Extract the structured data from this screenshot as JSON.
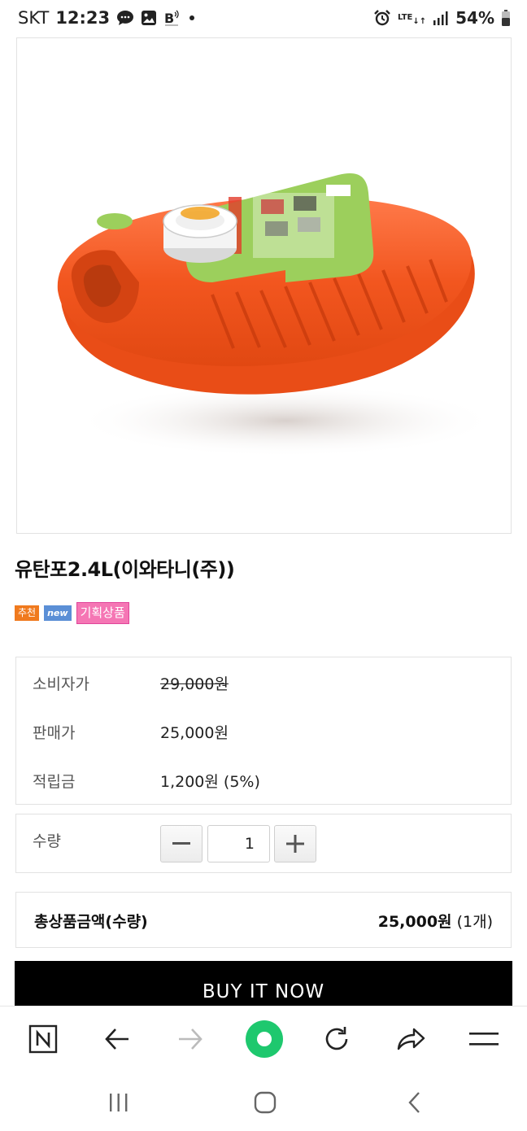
{
  "status_bar": {
    "carrier": "SKT",
    "time": "12:23",
    "network": "LTE",
    "battery": "54%",
    "icons": [
      "chat-icon",
      "gallery-icon",
      "b-icon",
      "dot-icon",
      "alarm-icon",
      "lte-icon",
      "signal-icon",
      "battery-icon"
    ]
  },
  "product": {
    "image_icon": "hot-water-bottle-image",
    "title": "유탄포2.4L(이와타니(주))",
    "badges": [
      "추천",
      "new",
      "기획상품"
    ]
  },
  "price": {
    "consumer_label": "소비자가",
    "consumer_value": "29,000원",
    "sale_label": "판매가",
    "sale_value": "25,000원",
    "points_label": "적립금",
    "points_value": "1,200원 (5%)"
  },
  "quantity": {
    "label": "수량",
    "value": "1"
  },
  "total": {
    "label": "총상품금액(수량)",
    "amount": "25,000원",
    "count": "(1개)"
  },
  "buy_button": {
    "label": "BUY IT NOW"
  },
  "browser_bar": {
    "icons": [
      "naver-home-icon",
      "back-arrow-icon",
      "forward-arrow-icon",
      "green-dot-icon",
      "refresh-icon",
      "share-icon",
      "menu-icon"
    ],
    "accent_color": "#1ec86e"
  },
  "nav_bar": {
    "icons": [
      "recent-apps-icon",
      "home-icon",
      "back-icon"
    ]
  }
}
